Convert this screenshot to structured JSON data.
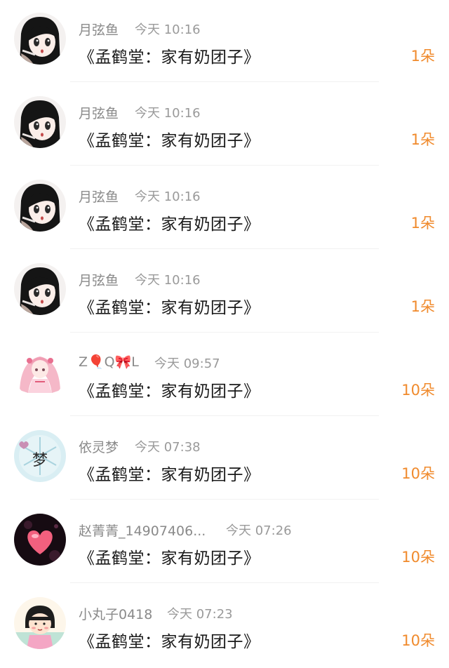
{
  "rows": [
    {
      "name": "月弦鱼",
      "time": "今天 10:16",
      "title": "《孟鹤堂：家有奶团子》",
      "amount": "1朵",
      "avatar": "anime-girl-dark-hair-avatar"
    },
    {
      "name": "月弦鱼",
      "time": "今天 10:16",
      "title": "《孟鹤堂：家有奶团子》",
      "amount": "1朵",
      "avatar": "anime-girl-dark-hair-avatar"
    },
    {
      "name": "月弦鱼",
      "time": "今天 10:16",
      "title": "《孟鹤堂：家有奶团子》",
      "amount": "1朵",
      "avatar": "anime-girl-dark-hair-avatar"
    },
    {
      "name": "月弦鱼",
      "time": "今天 10:16",
      "title": "《孟鹤堂：家有奶团子》",
      "amount": "1朵",
      "avatar": "anime-girl-dark-hair-avatar"
    },
    {
      "name": "Z🎈Q🎀L",
      "time": "今天 09:57",
      "title": "《孟鹤堂：家有奶团子》",
      "amount": "10朵",
      "avatar": "pink-anime-girl-avatar"
    },
    {
      "name": "依灵梦",
      "time": "今天 07:38",
      "title": "《孟鹤堂：家有奶团子》",
      "amount": "10朵",
      "avatar": "snowflake-meng-avatar"
    },
    {
      "name": "赵菁菁_14907406...",
      "time": "今天 07:26",
      "title": "《孟鹤堂：家有奶团子》",
      "amount": "10朵",
      "avatar": "pink-heart-avatar"
    },
    {
      "name": "小丸子0418",
      "time": "今天 07:23",
      "title": "《孟鹤堂：家有奶团子》",
      "amount": "10朵",
      "avatar": "chibi-maruko-avatar"
    }
  ],
  "colors": {
    "name_text": "#8a8a8a",
    "time_text": "#9a9a9a",
    "title_text": "#1a1a1a",
    "amount_accent": "#f08a2c",
    "divider": "#f1f1f1"
  }
}
